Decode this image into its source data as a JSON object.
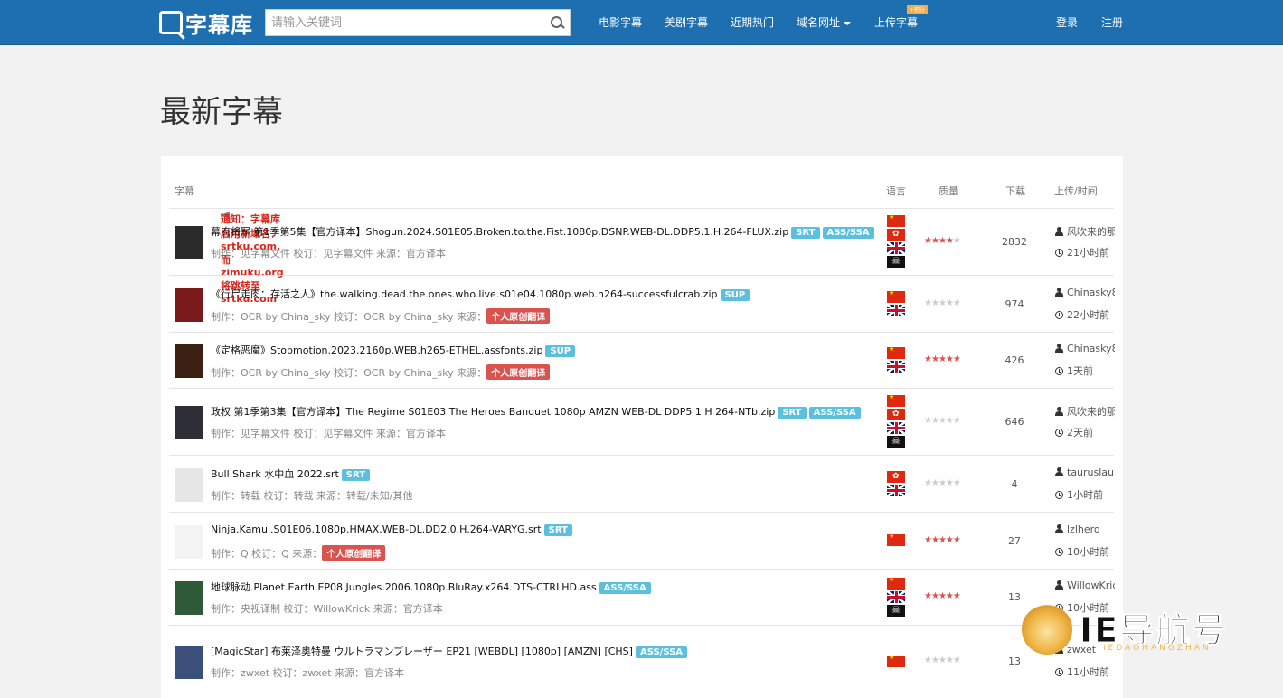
{
  "header": {
    "logo_text": "字幕库",
    "search_placeholder": "请输入关键词",
    "nav": [
      {
        "label": "电影字幕"
      },
      {
        "label": "美剧字幕"
      },
      {
        "label": "近期热门"
      },
      {
        "label": "域名网址"
      },
      {
        "label": "上传字幕"
      }
    ],
    "upload_badge": "+积分",
    "login": "登录",
    "register": "注册"
  },
  "page_title": "最新字幕",
  "table": {
    "col_subtitle": "字幕",
    "notice": "通知：字幕库启用新域名：srtku.com,而zimuku.org将跳转至srtku.com",
    "col_language": "语言",
    "col_quality": "质量",
    "col_downloads": "下载",
    "col_uploader": "上传/时间"
  },
  "rows": [
    {
      "title": "幕府将军 第1季第5集【官方译本】Shogun.2024.S01E05.Broken.to.the.Fist.1080p.DSNP.WEB-DL.DDP5.1.H.264-FLUX.zip",
      "tags": [
        "SRT",
        "ASS/SSA"
      ],
      "meta": "制作：见字幕文件 校订：见字幕文件 来源：官方译本",
      "meta_tag": "",
      "flags": [
        "cn",
        "hk",
        "gb",
        "pirate"
      ],
      "stars": 4,
      "downloads": "2832",
      "uploader": "风吹来的那",
      "time": "21小时前",
      "thumb_color": "#2b2b2b"
    },
    {
      "title": "《行尸走肉：存活之人》the.walking.dead.the.ones.who.live.s01e04.1080p.web.h264-successfulcrab.zip",
      "tags": [
        "SUP"
      ],
      "meta": "制作：OCR by China_sky 校订：OCR by China_sky 来源：",
      "meta_tag": "个人原创翻译",
      "flags": [
        "cn",
        "gb"
      ],
      "stars": 0,
      "downloads": "974",
      "uploader": "Chinasky8",
      "time": "22小时前",
      "thumb_color": "#7a1a1a"
    },
    {
      "title": "《定格恶魔》Stopmotion.2023.2160p.WEB.h265-ETHEL.assfonts.zip",
      "tags": [
        "SUP"
      ],
      "meta": "制作：OCR by China_sky 校订：OCR by China_sky 来源：",
      "meta_tag": "个人原创翻译",
      "flags": [
        "cn",
        "gb"
      ],
      "stars": 5,
      "downloads": "426",
      "uploader": "Chinasky8",
      "time": "1天前",
      "thumb_color": "#3a1f12"
    },
    {
      "title": "政权 第1季第3集【官方译本】The Regime S01E03 The Heroes Banquet 1080p AMZN WEB-DL DDP5 1 H 264-NTb.zip",
      "tags": [
        "SRT",
        "ASS/SSA"
      ],
      "meta": "制作：见字幕文件 校订：见字幕文件 来源：官方译本",
      "meta_tag": "",
      "flags": [
        "cn",
        "hk",
        "gb",
        "pirate"
      ],
      "stars": 0,
      "downloads": "646",
      "uploader": "风吹来的那",
      "time": "2天前",
      "thumb_color": "#2e2e36"
    },
    {
      "title": "Bull Shark 水中血 2022.srt",
      "tags": [
        "SRT"
      ],
      "meta": "制作：转载 校订：转载 来源：转载/未知/其他",
      "meta_tag": "",
      "flags": [
        "hk",
        "gb"
      ],
      "stars": 0,
      "downloads": "4",
      "uploader": "tauruslau",
      "time": "1小时前",
      "thumb_color": "#e6e6e6"
    },
    {
      "title": "Ninja.Kamui.S01E06.1080p.HMAX.WEB-DL.DD2.0.H.264-VARYG.srt",
      "tags": [
        "SRT"
      ],
      "meta": "制作：Q 校订：Q 来源：",
      "meta_tag": "个人原创翻译",
      "flags": [
        "cn"
      ],
      "stars": 5,
      "downloads": "27",
      "uploader": "lzlhero",
      "time": "10小时前",
      "thumb_color": "#f3f3f3"
    },
    {
      "title": "地球脉动.Planet.Earth.EP08.Jungles.2006.1080p.BluRay.x264.DTS-CTRLHD.ass",
      "tags": [
        "ASS/SSA"
      ],
      "meta": "制作：央视译制 校订：WillowKrick 来源：官方译本",
      "meta_tag": "",
      "flags": [
        "cn",
        "gb",
        "pirate"
      ],
      "stars": 5,
      "downloads": "13",
      "uploader": "WillowKric",
      "time": "10小时前",
      "thumb_color": "#2f5a3a"
    },
    {
      "title": "[MagicStar] 布莱泽奥特曼 ウルトラマンブレーザー EP21 [WEBDL] [1080p] [AMZN] [CHS]",
      "tags": [
        "ASS/SSA"
      ],
      "meta": "制作：zwxet 校订：zwxet 来源：官方译本",
      "meta_tag": "",
      "flags": [
        "cn"
      ],
      "stars": 0,
      "downloads": "13",
      "uploader": "zwxet",
      "time": "11小时前",
      "thumb_color": "#3a4f7a"
    }
  ],
  "watermark": {
    "text": "IE导航号",
    "subtext": "IEDAOHANGZHAN"
  }
}
